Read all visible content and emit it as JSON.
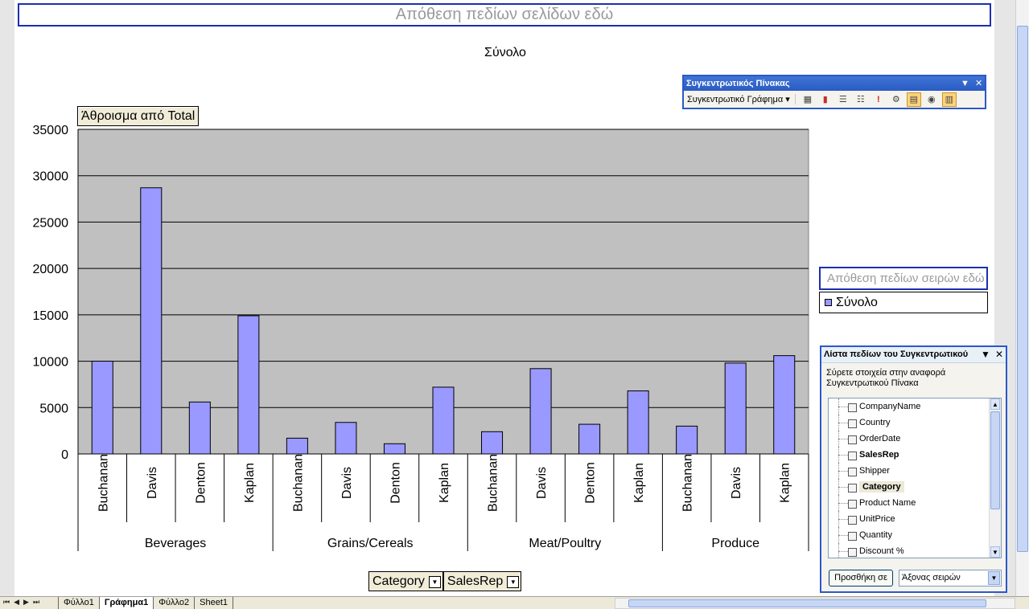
{
  "page_drop_zone": "Απόθεση πεδίων σελίδων εδώ",
  "chart_title": "Σύνολο",
  "data_field_button": "Άθροισμα από Total",
  "series_drop_zone": "Απόθεση πεδίων σειρών εδώ",
  "legend": {
    "label": "Σύνολο",
    "color": "#9999ff"
  },
  "axis_buttons": {
    "category": "Category",
    "salesrep": "SalesRep"
  },
  "pivot_toolbar": {
    "title": "Συγκεντρωτικός Πίνακας",
    "menu": "Συγκεντρωτικό Γράφημα",
    "icons": [
      "format-report-icon",
      "chart-wizard-icon",
      "hide-detail-icon",
      "show-detail-icon",
      "refresh-data-icon",
      "field-settings-icon",
      "show-field-list-icon",
      "table-options-icon",
      "field-list-active-icon"
    ]
  },
  "field_list": {
    "title": "Λίστα πεδίων του Συγκεντρωτικού",
    "description": "Σύρετε στοιχεία στην αναφορά Συγκεντρωτικού Πίνακα",
    "items": [
      {
        "label": "CompanyName",
        "bold": false,
        "selected": false
      },
      {
        "label": "Country",
        "bold": false,
        "selected": false
      },
      {
        "label": "OrderDate",
        "bold": false,
        "selected": false
      },
      {
        "label": "SalesRep",
        "bold": true,
        "selected": false
      },
      {
        "label": "Shipper",
        "bold": false,
        "selected": false
      },
      {
        "label": "Category",
        "bold": true,
        "selected": true
      },
      {
        "label": "Product Name",
        "bold": false,
        "selected": false
      },
      {
        "label": "UnitPrice",
        "bold": false,
        "selected": false
      },
      {
        "label": "Quantity",
        "bold": false,
        "selected": false
      },
      {
        "label": "Discount %",
        "bold": false,
        "selected": false
      }
    ],
    "add_button": "Προσθήκη σε",
    "area_select": "Άξονας σειρών"
  },
  "sheet_tabs": [
    {
      "label": "Φύλλο1",
      "active": false
    },
    {
      "label": "Γράφημα1",
      "active": true
    },
    {
      "label": "Φύλλο2",
      "active": false
    },
    {
      "label": "Sheet1",
      "active": false
    }
  ],
  "chart_data": {
    "type": "bar",
    "groups": [
      {
        "name": "Beverages",
        "categories": [
          "Buchanan",
          "Davis",
          "Denton",
          "Kaplan"
        ],
        "values": [
          10000,
          28700,
          5600,
          14900
        ]
      },
      {
        "name": "Grains/Cereals",
        "categories": [
          "Buchanan",
          "Davis",
          "Denton",
          "Kaplan"
        ],
        "values": [
          1700,
          3400,
          1100,
          7200
        ]
      },
      {
        "name": "Meat/Poultry",
        "categories": [
          "Buchanan",
          "Davis",
          "Denton",
          "Kaplan"
        ],
        "values": [
          2400,
          9200,
          3200,
          6800
        ]
      },
      {
        "name": "Produce",
        "categories": [
          "Buchanan",
          "Davis",
          "Kaplan"
        ],
        "values": [
          3000,
          9800,
          10600
        ]
      }
    ],
    "series": [
      {
        "name": "Σύνολο"
      }
    ],
    "ylim": [
      0,
      35000
    ],
    "yticks": [
      0,
      5000,
      10000,
      15000,
      20000,
      25000,
      30000,
      35000
    ],
    "grid": true,
    "plot_background": "#c0c0c0",
    "bar_color": "#9999ff"
  }
}
